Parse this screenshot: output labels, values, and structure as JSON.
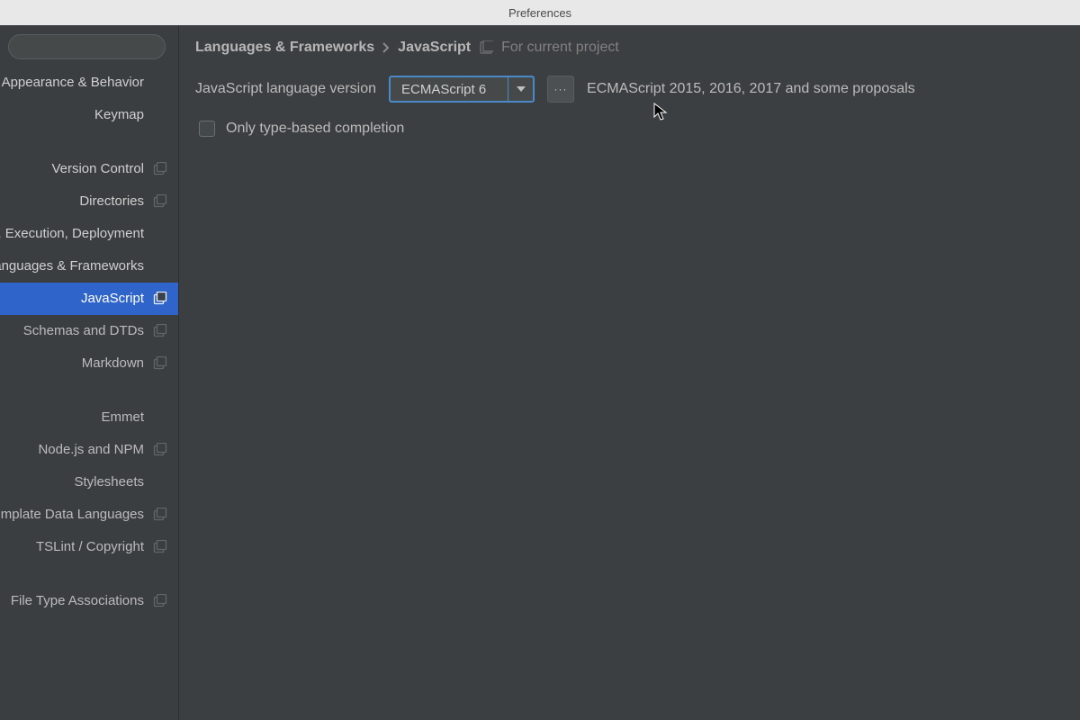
{
  "titlebar": {
    "title": "Preferences"
  },
  "sidebar": {
    "items": [
      {
        "label": "Appearance & Behavior",
        "top": true,
        "scope": false,
        "selected": false
      },
      {
        "label": "Keymap",
        "top": true,
        "scope": false,
        "selected": false,
        "gapAfter": true
      },
      {
        "label": "Version Control",
        "top": true,
        "scope": true,
        "selected": false
      },
      {
        "label": "Directories",
        "top": true,
        "scope": true,
        "selected": false
      },
      {
        "label": "Build, Execution, Deployment",
        "top": true,
        "scope": false,
        "selected": false
      },
      {
        "label": "Languages & Frameworks",
        "top": true,
        "scope": false,
        "selected": false
      },
      {
        "label": "JavaScript",
        "top": false,
        "scope": true,
        "selected": true
      },
      {
        "label": "Schemas and DTDs",
        "top": false,
        "scope": true,
        "selected": false
      },
      {
        "label": "Markdown",
        "top": false,
        "scope": true,
        "selected": false
      },
      {
        "label": "Emmet",
        "top": false,
        "scope": false,
        "selected": false,
        "gapBefore": true
      },
      {
        "label": "Node.js and NPM",
        "top": false,
        "scope": true,
        "selected": false
      },
      {
        "label": "Stylesheets",
        "top": false,
        "scope": false,
        "selected": false
      },
      {
        "label": "Template Data Languages",
        "top": false,
        "scope": true,
        "selected": false
      },
      {
        "label": "TSLint / Copyright",
        "top": false,
        "scope": true,
        "selected": false
      },
      {
        "label": "File Type Associations",
        "top": false,
        "scope": true,
        "selected": false,
        "gapBefore": true
      }
    ]
  },
  "breadcrumb": {
    "parent": "Languages & Frameworks",
    "current": "JavaScript",
    "hint": "For current project"
  },
  "main": {
    "versionLabel": "JavaScript language version",
    "versionValue": "ECMAScript 6",
    "ellipsis": "···",
    "versionDesc": "ECMAScript 2015, 2016, 2017 and some proposals",
    "typeCompletionLabel": "Only type-based completion"
  }
}
